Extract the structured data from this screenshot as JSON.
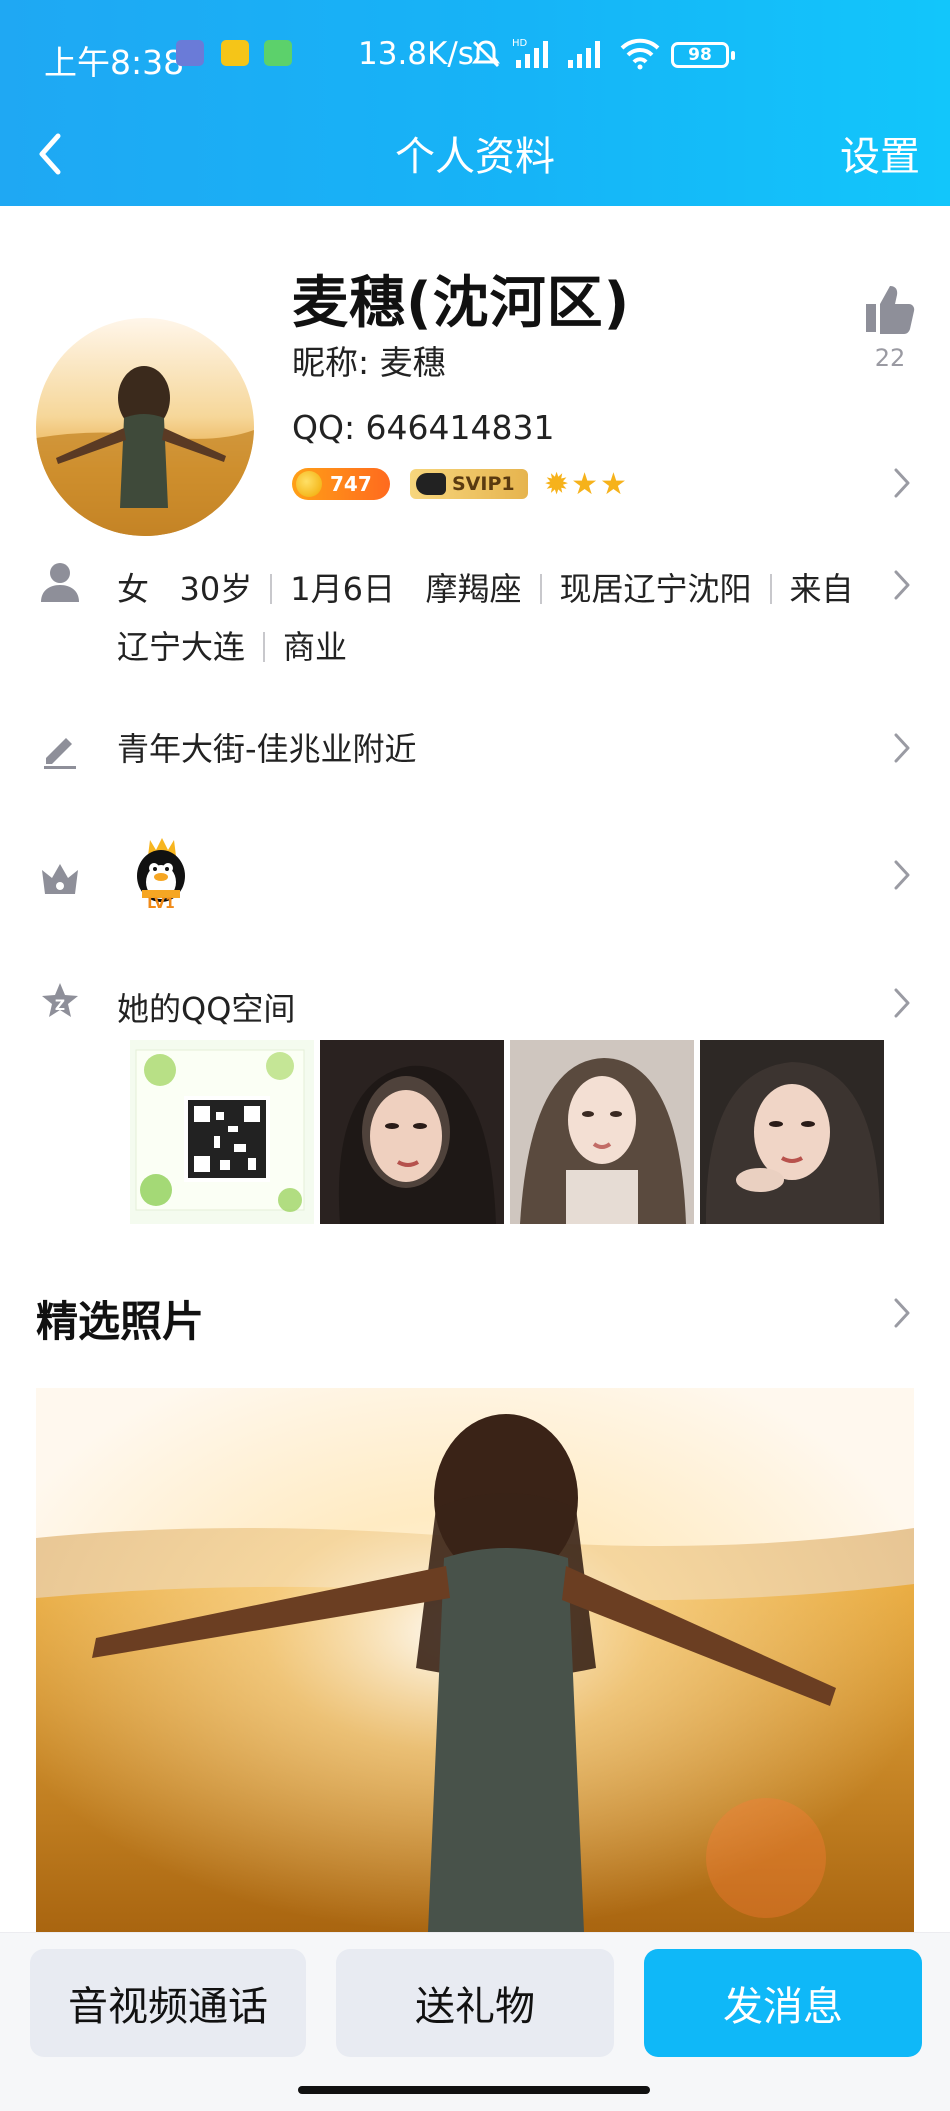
{
  "status_bar": {
    "time": "上午8:38",
    "net_speed": "13.8K/s",
    "battery": "98"
  },
  "nav": {
    "title": "个人资料",
    "right_label": "设置"
  },
  "profile": {
    "name": "麦穗(沈河区)",
    "nickname": "昵称: 麦穗",
    "qq": "QQ: 646414831",
    "level_badge": "747",
    "svip_badge": "SVIP1",
    "stars": "✹★★",
    "likes": "22"
  },
  "info": {
    "gender": "女",
    "age": "30岁",
    "birthday": "1月6日",
    "zodiac": "摩羯座",
    "residence": "现居辽宁沈阳",
    "hometown": "来自辽宁大连",
    "hometown_1": "来自",
    "hometown_2": "辽宁大连",
    "industry": "商业"
  },
  "signature": "青年大街-佳兆业附近",
  "qq_level": "LV1",
  "qzone": {
    "label": "她的QQ空间"
  },
  "featured": {
    "title": "精选照片"
  },
  "actions": {
    "call": "音视频通话",
    "gift": "送礼物",
    "message": "发消息"
  },
  "colors": {
    "header_start": "#1fa8f3",
    "header_end": "#12c6fb",
    "primary_button": "#0fb8f8",
    "secondary_button": "#e8ebf2"
  }
}
